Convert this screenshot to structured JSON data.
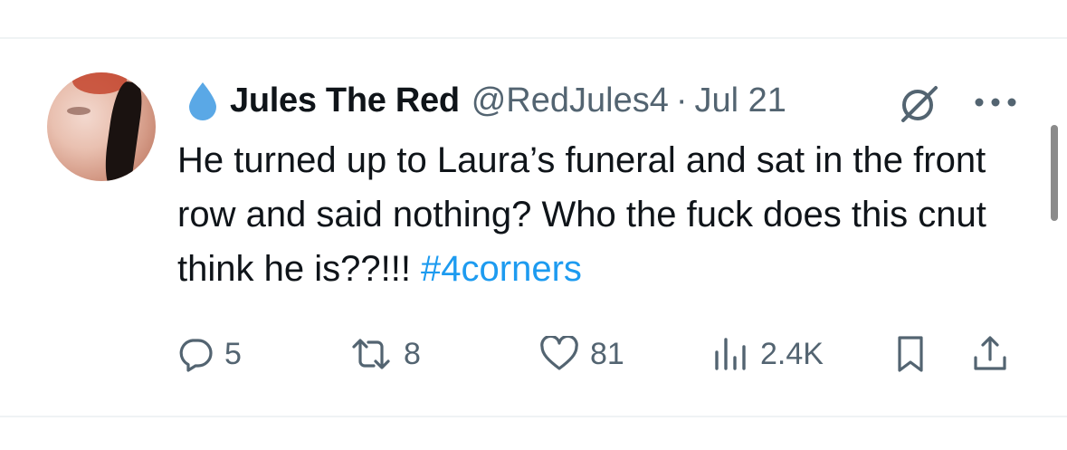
{
  "tweet": {
    "display_name": "Jules The Red",
    "handle": "@RedJules4",
    "separator": "·",
    "date": "Jul 21",
    "text_before": "He turned up to Laura’s funeral and sat in the front row and said nothing? Who the fuck does this cnut think he is??!!! ",
    "hashtag": "#4corners"
  },
  "actions": {
    "replies": "5",
    "reposts": "8",
    "likes": "81",
    "views": "2.4K"
  },
  "icons": {
    "drop": "water-drop-icon",
    "grok": "grok-icon",
    "more": "more-icon",
    "reply": "reply-icon",
    "repost": "repost-icon",
    "like": "heart-icon",
    "views": "views-icon",
    "bookmark": "bookmark-icon",
    "share": "share-icon"
  },
  "colors": {
    "text": "#0f1419",
    "secondary": "#536471",
    "link": "#1d9bf0",
    "drop": "#5aa8e6",
    "divider": "#eff3f4"
  }
}
